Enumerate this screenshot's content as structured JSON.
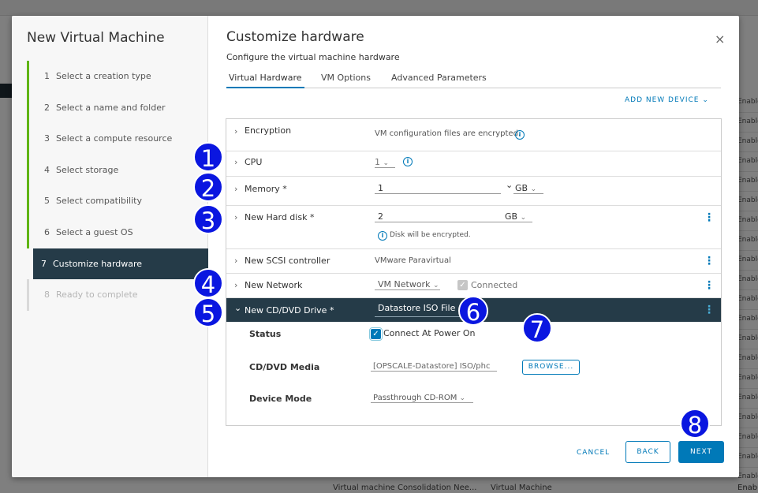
{
  "wizard": {
    "title": "New Virtual Machine",
    "steps": [
      {
        "num": "1",
        "label": "Select a creation type"
      },
      {
        "num": "2",
        "label": "Select a name and folder"
      },
      {
        "num": "3",
        "label": "Select a compute resource"
      },
      {
        "num": "4",
        "label": "Select storage"
      },
      {
        "num": "5",
        "label": "Select compatibility"
      },
      {
        "num": "6",
        "label": "Select a guest OS"
      },
      {
        "num": "7",
        "label": "Customize hardware"
      },
      {
        "num": "8",
        "label": "Ready to complete"
      }
    ]
  },
  "header": {
    "title": "Customize hardware",
    "subtitle": "Configure the virtual machine hardware",
    "close": "×"
  },
  "tabs": [
    "Virtual Hardware",
    "VM Options",
    "Advanced Parameters"
  ],
  "add_device": "ADD NEW DEVICE ⌄",
  "hardware": {
    "encryption": {
      "label": "Encryption",
      "value": "VM configuration files are encrypted."
    },
    "cpu": {
      "label": "CPU",
      "value": "1"
    },
    "memory": {
      "label": "Memory *",
      "value": "1",
      "unit": "GB"
    },
    "hard_disk": {
      "label": "New Hard disk *",
      "value": "2",
      "unit": "GB",
      "note": "Disk will be encrypted."
    },
    "scsi": {
      "label": "New SCSI controller",
      "value": "VMware Paravirtual"
    },
    "network": {
      "label": "New Network",
      "value": "VM Network",
      "connected": "Connected"
    },
    "cdrom": {
      "label": "New CD/DVD Drive *",
      "value": "Datastore ISO File",
      "status_label": "Status",
      "status_value": "Connect At Power On",
      "media_label": "CD/DVD Media",
      "media_value": "[OPSCALE-Datastore] ISO/phc",
      "browse": "BROWSE...",
      "mode_label": "Device Mode",
      "mode_value": "Passthrough CD-ROM"
    }
  },
  "footer": {
    "cancel": "CANCEL",
    "back": "BACK",
    "next": "NEXT"
  },
  "background": {
    "column_values": [
      "Enable",
      "Enable",
      "Enable",
      "Enable",
      "Enable",
      "Enable",
      "Enable",
      "Enable",
      "Enable",
      "Enable",
      "Enable",
      "Enable",
      "Enable",
      "Enable",
      "Enable",
      "Enable",
      "Enable",
      "Enable",
      "Enable",
      "Enable"
    ],
    "bottom_row": [
      "Virtual machine Consolidation Nee...",
      "Virtual Machine",
      "Enable"
    ]
  },
  "badges": [
    "1",
    "2",
    "3",
    "4",
    "5",
    "6",
    "7",
    "8"
  ],
  "colors": {
    "accent": "#0079b8",
    "badge": "#0a16e0",
    "dark_row": "#253b48",
    "step_done": "#60b515"
  }
}
